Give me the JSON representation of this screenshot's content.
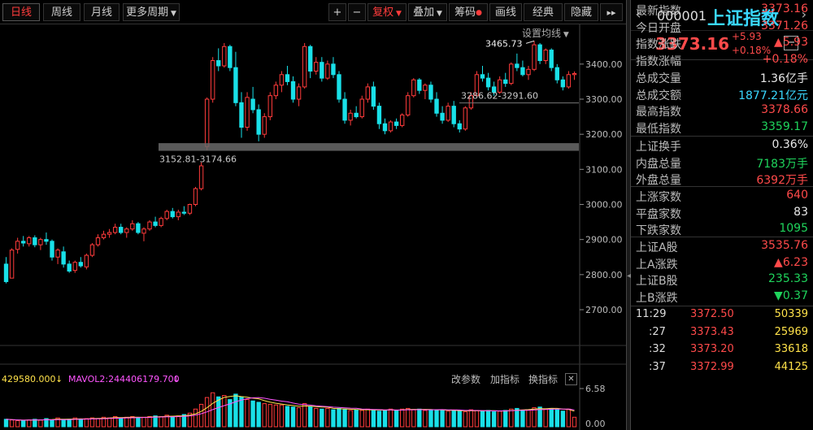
{
  "toolbar": {
    "period_tabs": [
      "日线",
      "周线",
      "月线",
      "更多周期"
    ],
    "plus": "+",
    "minus": "−",
    "adjust": "复权",
    "overlay": "叠加",
    "chips": "筹码",
    "draw": "画线",
    "classic": "经典",
    "hide": "隐藏",
    "expand": "▸▸"
  },
  "chart": {
    "settings": "设置均线",
    "annotations": {
      "high": "3465.73",
      "range1": "3286.62-3291.60",
      "range2": "3152.81-3174.66"
    }
  },
  "volume": {
    "mavol1": "429580.000",
    "mavol2": "MAVOL2:244406179.700",
    "change_params": "改参数",
    "add_indicator": "加指标",
    "switch_indicator": "换指标",
    "close": "✕",
    "axis_top": "6.58",
    "axis_bottom": "0.00"
  },
  "chart_data": {
    "type": "candlestick",
    "y_ticks": [
      2700,
      2800,
      2900,
      3000,
      3100,
      3200,
      3300,
      3400
    ],
    "y_tick_labels": [
      "2700.00",
      "2800.00",
      "2900.00",
      "3000.00",
      "3100.00",
      "3200.00",
      "3300.00",
      "3400.00"
    ],
    "ylim": [
      2605,
      3490
    ],
    "volume_ylim": [
      0,
      6.58
    ],
    "ohlc": [
      [
        2830,
        2850,
        2775,
        2780
      ],
      [
        2790,
        2875,
        2790,
        2870
      ],
      [
        2872,
        2905,
        2860,
        2895
      ],
      [
        2895,
        2910,
        2880,
        2890
      ],
      [
        2888,
        2910,
        2880,
        2905
      ],
      [
        2905,
        2912,
        2878,
        2885
      ],
      [
        2885,
        2905,
        2870,
        2900
      ],
      [
        2900,
        2920,
        2885,
        2895
      ],
      [
        2895,
        2900,
        2840,
        2850
      ],
      [
        2850,
        2875,
        2830,
        2870
      ],
      [
        2865,
        2880,
        2820,
        2830
      ],
      [
        2830,
        2840,
        2805,
        2810
      ],
      [
        2812,
        2840,
        2805,
        2835
      ],
      [
        2835,
        2850,
        2820,
        2825
      ],
      [
        2822,
        2860,
        2815,
        2855
      ],
      [
        2855,
        2890,
        2850,
        2885
      ],
      [
        2885,
        2915,
        2880,
        2905
      ],
      [
        2905,
        2925,
        2900,
        2915
      ],
      [
        2915,
        2930,
        2905,
        2920
      ],
      [
        2920,
        2945,
        2915,
        2935
      ],
      [
        2935,
        2945,
        2915,
        2920
      ],
      [
        2920,
        2935,
        2905,
        2930
      ],
      [
        2930,
        2955,
        2925,
        2945
      ],
      [
        2945,
        2950,
        2915,
        2920
      ],
      [
        2918,
        2935,
        2895,
        2930
      ],
      [
        2930,
        2955,
        2925,
        2950
      ],
      [
        2950,
        2965,
        2935,
        2940
      ],
      [
        2940,
        2965,
        2935,
        2960
      ],
      [
        2960,
        2985,
        2955,
        2980
      ],
      [
        2980,
        2990,
        2960,
        2965
      ],
      [
        2965,
        2985,
        2955,
        2978
      ],
      [
        2978,
        2995,
        2970,
        2975
      ],
      [
        2975,
        3002,
        2970,
        3000
      ],
      [
        3000,
        3050,
        2995,
        3045
      ],
      [
        3045,
        3120,
        3040,
        3110
      ],
      [
        3165,
        3305,
        3155,
        3300
      ],
      [
        3300,
        3420,
        3290,
        3410
      ],
      [
        3410,
        3445,
        3380,
        3395
      ],
      [
        3395,
        3460,
        3390,
        3450
      ],
      [
        3450,
        3455,
        3380,
        3390
      ],
      [
        3390,
        3435,
        3280,
        3290
      ],
      [
        3290,
        3320,
        3190,
        3220
      ],
      [
        3220,
        3320,
        3210,
        3305
      ],
      [
        3300,
        3335,
        3260,
        3270
      ],
      [
        3270,
        3285,
        3180,
        3200
      ],
      [
        3200,
        3260,
        3190,
        3250
      ],
      [
        3250,
        3320,
        3240,
        3310
      ],
      [
        3310,
        3350,
        3300,
        3340
      ],
      [
        3340,
        3380,
        3320,
        3370
      ],
      [
        3370,
        3395,
        3340,
        3350
      ],
      [
        3350,
        3365,
        3290,
        3300
      ],
      [
        3300,
        3345,
        3280,
        3335
      ],
      [
        3335,
        3460,
        3330,
        3450
      ],
      [
        3450,
        3455,
        3360,
        3380
      ],
      [
        3380,
        3420,
        3370,
        3405
      ],
      [
        3405,
        3420,
        3350,
        3360
      ],
      [
        3360,
        3410,
        3355,
        3400
      ],
      [
        3400,
        3420,
        3360,
        3370
      ],
      [
        3370,
        3380,
        3290,
        3300
      ],
      [
        3300,
        3320,
        3230,
        3240
      ],
      [
        3240,
        3270,
        3225,
        3260
      ],
      [
        3260,
        3280,
        3245,
        3250
      ],
      [
        3250,
        3310,
        3245,
        3300
      ],
      [
        3300,
        3345,
        3290,
        3335
      ],
      [
        3335,
        3350,
        3270,
        3280
      ],
      [
        3280,
        3290,
        3215,
        3230
      ],
      [
        3230,
        3245,
        3200,
        3210
      ],
      [
        3210,
        3240,
        3205,
        3235
      ],
      [
        3235,
        3245,
        3215,
        3225
      ],
      [
        3225,
        3260,
        3220,
        3255
      ],
      [
        3255,
        3320,
        3250,
        3310
      ],
      [
        3310,
        3360,
        3305,
        3355
      ],
      [
        3355,
        3360,
        3315,
        3325
      ],
      [
        3325,
        3345,
        3300,
        3340
      ],
      [
        3340,
        3350,
        3290,
        3300
      ],
      [
        3300,
        3320,
        3250,
        3260
      ],
      [
        3260,
        3280,
        3230,
        3240
      ],
      [
        3240,
        3290,
        3235,
        3280
      ],
      [
        3280,
        3295,
        3220,
        3230
      ],
      [
        3230,
        3240,
        3205,
        3215
      ],
      [
        3215,
        3280,
        3210,
        3275
      ],
      [
        3275,
        3320,
        3270,
        3310
      ],
      [
        3310,
        3380,
        3305,
        3370
      ],
      [
        3370,
        3395,
        3350,
        3360
      ],
      [
        3360,
        3375,
        3325,
        3335
      ],
      [
        3335,
        3350,
        3310,
        3320
      ],
      [
        3320,
        3365,
        3315,
        3355
      ],
      [
        3355,
        3375,
        3335,
        3345
      ],
      [
        3345,
        3405,
        3340,
        3400
      ],
      [
        3400,
        3430,
        3380,
        3390
      ],
      [
        3390,
        3410,
        3365,
        3370
      ],
      [
        3370,
        3395,
        3355,
        3385
      ],
      [
        3385,
        3466,
        3380,
        3455
      ],
      [
        3455,
        3460,
        3400,
        3410
      ],
      [
        3410,
        3445,
        3400,
        3440
      ],
      [
        3440,
        3445,
        3380,
        3390
      ],
      [
        3390,
        3400,
        3345,
        3355
      ],
      [
        3355,
        3365,
        3325,
        3335
      ],
      [
        3335,
        3380,
        3330,
        3370
      ],
      [
        3370,
        3379,
        3355,
        3373
      ]
    ],
    "volumes": [
      1.1,
      1.0,
      0.9,
      0.9,
      1.0,
      1.1,
      1.0,
      1.2,
      1.0,
      1.3,
      1.0,
      1.1,
      1.3,
      1.1,
      1.2,
      1.3,
      1.2,
      1.4,
      1.3,
      1.5,
      1.3,
      1.4,
      1.5,
      1.3,
      1.4,
      1.5,
      1.6,
      1.5,
      1.7,
      1.5,
      1.6,
      1.8,
      2.0,
      2.6,
      3.3,
      4.3,
      5.0,
      4.4,
      4.6,
      4.0,
      4.8,
      4.4,
      4.0,
      3.8,
      3.6,
      3.4,
      3.3,
      3.2,
      3.2,
      3.0,
      2.9,
      2.8,
      3.4,
      3.0,
      2.7,
      2.6,
      2.7,
      2.5,
      2.7,
      2.6,
      2.4,
      2.5,
      2.4,
      2.6,
      2.5,
      2.3,
      2.4,
      2.6,
      2.4,
      2.6,
      2.7,
      2.5,
      2.6,
      2.4,
      2.5,
      2.4,
      2.5,
      2.3,
      2.4,
      2.3,
      2.2,
      2.5,
      2.4,
      2.3,
      2.4,
      2.2,
      2.3,
      2.4,
      2.6,
      2.7,
      2.4,
      2.5,
      2.8,
      2.9,
      2.6,
      2.7,
      2.5,
      2.3,
      2.6,
      1.4
    ]
  },
  "panel": {
    "code": "000001",
    "name": "上证指数",
    "price": "3373.16",
    "change": "+5.93",
    "change_pct": "+0.18%",
    "minimize": "−",
    "stats": [
      {
        "label": "最新指数",
        "value": "3373.16",
        "color": "#ff4a4a"
      },
      {
        "label": "今日开盘",
        "value": "3371.26",
        "color": "#ff4a4a"
      },
      {
        "label": "指数涨跌",
        "value": "▲5.93",
        "color": "#ff4a4a"
      },
      {
        "label": "指数涨幅",
        "value": "+0.18%",
        "color": "#ff4a4a"
      },
      {
        "label": "总成交量",
        "value": "1.36亿手",
        "color": "#e8e8e8"
      },
      {
        "label": "总成交额",
        "value": "1877.21亿元",
        "color": "#3ad8ff"
      },
      {
        "label": "最高指数",
        "value": "3378.66",
        "color": "#ff4a4a"
      },
      {
        "label": "最低指数",
        "value": "3359.17",
        "color": "#1fd45c"
      }
    ],
    "stats2": [
      {
        "label": "上证换手",
        "value": "0.36%",
        "color": "#e8e8e8"
      },
      {
        "label": "内盘总量",
        "value": "7183万手",
        "color": "#1fd45c"
      },
      {
        "label": "外盘总量",
        "value": "6392万手",
        "color": "#ff4a4a"
      }
    ],
    "stats3": [
      {
        "label": "上涨家数",
        "value": "640",
        "color": "#ff4a4a"
      },
      {
        "label": "平盘家数",
        "value": "83",
        "color": "#e8e8e8"
      },
      {
        "label": "下跌家数",
        "value": "1095",
        "color": "#1fd45c"
      }
    ],
    "stats4": [
      {
        "label": "上证A股",
        "value": "3535.76",
        "color": "#ff4a4a"
      },
      {
        "label": "上A涨跌",
        "value": "▲6.23",
        "color": "#ff4a4a"
      },
      {
        "label": "上证B股",
        "value": "235.33",
        "color": "#1fd45c"
      },
      {
        "label": "上B涨跌",
        "value": "▼0.37",
        "color": "#1fd45c"
      }
    ],
    "ticks": [
      {
        "time": "11:29",
        "price": "3372.50",
        "vol": "50339"
      },
      {
        "time": ":27",
        "price": "3373.43",
        "vol": "25969"
      },
      {
        "time": ":32",
        "price": "3373.20",
        "vol": "33618"
      },
      {
        "time": ":37",
        "price": "3372.99",
        "vol": "44125"
      }
    ]
  }
}
